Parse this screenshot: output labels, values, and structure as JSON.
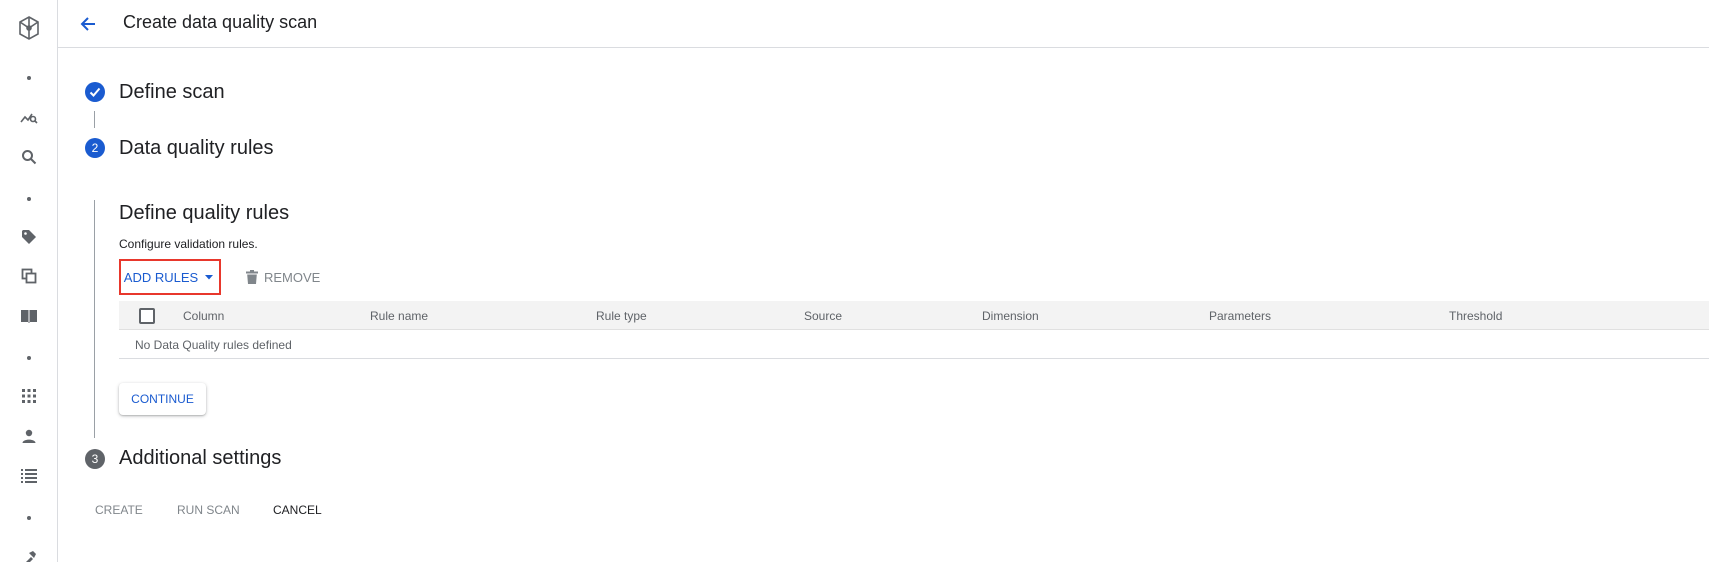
{
  "header": {
    "title": "Create data quality scan",
    "back_icon": "arrow-back-icon"
  },
  "steps": [
    {
      "state": "complete",
      "label": "Define scan",
      "icon": "check-circle-icon"
    },
    {
      "state": "active",
      "number": "2",
      "label": "Data quality rules"
    },
    {
      "state": "pending",
      "number": "3",
      "label": "Additional settings"
    }
  ],
  "rules_section": {
    "title": "Define quality rules",
    "description": "Configure validation rules.",
    "add_rules_label": "ADD RULES",
    "remove_label": "REMOVE",
    "continue_label": "CONTINUE"
  },
  "table": {
    "columns": [
      "Column",
      "Rule name",
      "Rule type",
      "Source",
      "Dimension",
      "Parameters",
      "Threshold"
    ],
    "empty_message": "No Data Quality rules defined"
  },
  "footer": {
    "create_label": "CREATE",
    "run_scan_label": "RUN SCAN",
    "cancel_label": "CANCEL"
  },
  "colors": {
    "accent": "#1a5bd0",
    "step_complete": "#1a5bd0",
    "step_pending": "#5f6368",
    "highlight": "#e8372c"
  }
}
